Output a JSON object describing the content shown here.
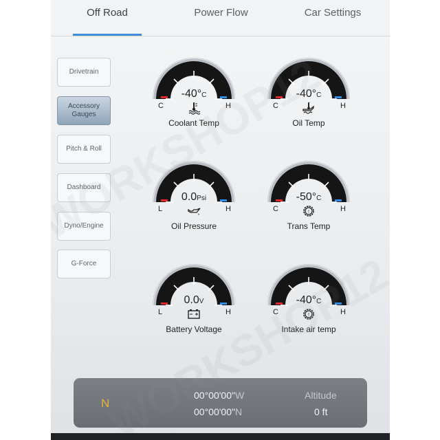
{
  "tabs": [
    {
      "label": "Off Road",
      "active": true
    },
    {
      "label": "Power Flow",
      "active": false
    },
    {
      "label": "Car Settings",
      "active": false
    }
  ],
  "sidebar": {
    "items": [
      {
        "label": "Drivetrain",
        "active": false
      },
      {
        "label": "Accessory Gauges",
        "active": true
      },
      {
        "label": "Pitch & Roll",
        "active": false
      },
      {
        "label": "Dashboard",
        "active": false
      },
      {
        "label": "Dyno/Engine",
        "active": false
      },
      {
        "label": "G-Force",
        "active": false
      }
    ]
  },
  "gauges": [
    {
      "label": "Coolant Temp",
      "value": "-40°",
      "unit": "C",
      "left": "C",
      "right": "H",
      "icon": "coolant-temperature-icon"
    },
    {
      "label": "Oil Temp",
      "value": "-40°",
      "unit": "C",
      "left": "C",
      "right": "H",
      "icon": "oil-temperature-icon"
    },
    {
      "label": "Oil Pressure",
      "value": "0.0",
      "unit": "Psi",
      "left": "L",
      "right": "H",
      "icon": "oil-can-icon"
    },
    {
      "label": "Trans Temp",
      "value": "-50°",
      "unit": "C",
      "left": "C",
      "right": "H",
      "icon": "transmission-icon"
    },
    {
      "label": "Battery Voltage",
      "value": "0.0",
      "unit": "V",
      "left": "L",
      "right": "H",
      "icon": "battery-icon"
    },
    {
      "label": "Intake air temp",
      "value": "-40°",
      "unit": "C",
      "left": "C",
      "right": "H",
      "icon": "intake-air-icon"
    }
  ],
  "nav": {
    "heading": "N",
    "longitude": "00°00'00\"",
    "longitude_dir": "W",
    "latitude": "00°00'00\"",
    "latitude_dir": "N",
    "altitude_label": "Altitude",
    "altitude_value": "0 ft"
  },
  "watermark": {
    "text": "WORKSHOP12"
  },
  "colors": {
    "accent": "#3e8fd6",
    "cold_marker": "#e0282e",
    "hot_marker": "#2f8fe6",
    "heading": "#e8b23a"
  }
}
